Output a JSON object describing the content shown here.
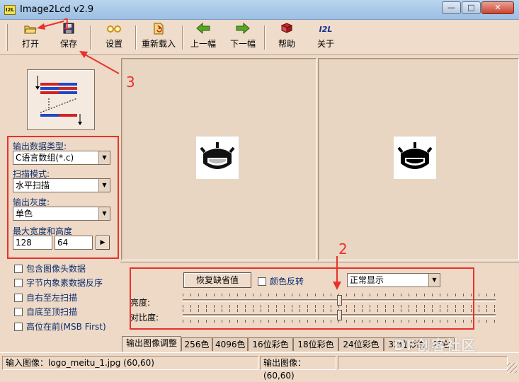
{
  "window": {
    "title": "Image2Lcd v2.9",
    "app_icon_text": "I2L",
    "controls": [
      "minimize",
      "maximize",
      "close"
    ]
  },
  "toolbar": {
    "buttons": [
      {
        "label": "打开",
        "icon": "open-folder-icon"
      },
      {
        "label": "保存",
        "icon": "floppy-disk-icon"
      },
      {
        "label": "设置",
        "icon": "glasses-icon"
      },
      {
        "label": "重新载入",
        "icon": "reload-icon"
      },
      {
        "label": "上一幅",
        "icon": "arrow-left-icon"
      },
      {
        "label": "下一幅",
        "icon": "arrow-right-icon"
      },
      {
        "label": "帮助",
        "icon": "help-book-icon"
      },
      {
        "label": "关于",
        "icon": "i2l-logo-icon",
        "glyph": "I2L"
      }
    ]
  },
  "settings": {
    "output_type_label": "输出数据类型:",
    "output_type_value": "C语言数组(*.c)",
    "scan_mode_label": "扫描模式:",
    "scan_mode_value": "水平扫描",
    "gray_label": "输出灰度:",
    "gray_value": "单色",
    "max_size_label": "最大宽度和高度",
    "max_width": "128",
    "max_height": "64"
  },
  "options": [
    {
      "label": "包含图像头数据",
      "checked": false
    },
    {
      "label": "字节内象素数据反序",
      "checked": false
    },
    {
      "label": "自右至左扫描",
      "checked": false
    },
    {
      "label": "自底至顶扫描",
      "checked": false
    },
    {
      "label": "高位在前(MSB First)",
      "checked": false
    }
  ],
  "adjust": {
    "restore_default_label": "恢复缺省值",
    "invert_color_label": "颜色反转",
    "display_mode_value": "正常显示",
    "brightness_label": "亮度:",
    "contrast_label": "对比度:",
    "brightness_value": 0.5,
    "contrast_value": 0.5
  },
  "tabs": [
    "输出图像调整",
    "256色",
    "4096色",
    "16位彩色",
    "18位彩色",
    "24位彩色",
    "32位彩色",
    "其它"
  ],
  "status": {
    "input": "输入图像：logo_meitu_1.jpg (60,60)",
    "output": "输出图像：(60,60)"
  },
  "annotations": {
    "numbers": [
      "1",
      "2",
      "3"
    ],
    "color": "#e8322b"
  },
  "watermark": "DF创客社区",
  "colors": {
    "titlebar": "#b9d4ee",
    "background": "#edd9c6",
    "annotation": "#e8322b"
  }
}
